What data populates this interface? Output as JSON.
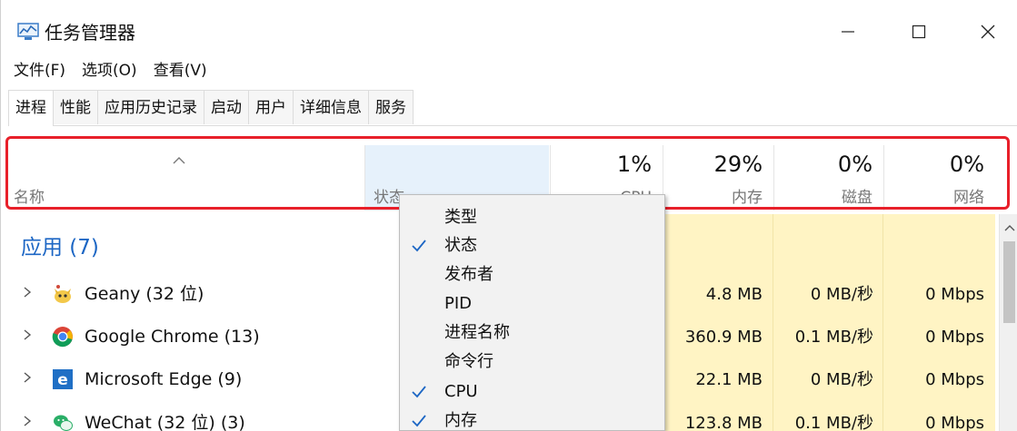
{
  "window": {
    "title": "任务管理器",
    "controls": {
      "minimize": "—",
      "maximize": "☐",
      "close": "✕"
    }
  },
  "menu": [
    "文件(F)",
    "选项(O)",
    "查看(V)"
  ],
  "tabs": [
    "进程",
    "性能",
    "应用历史记录",
    "启动",
    "用户",
    "详细信息",
    "服务"
  ],
  "header": {
    "name_label": "名称",
    "status_label": "状态",
    "cpu": {
      "pct": "1%",
      "label": "CPU"
    },
    "memory": {
      "pct": "29%",
      "label": "内存"
    },
    "disk": {
      "pct": "0%",
      "label": "磁盘"
    },
    "network": {
      "pct": "0%",
      "label": "网络"
    }
  },
  "group": {
    "label": "应用 (7)"
  },
  "rows": [
    {
      "name": "Geany (32 位)",
      "icon": "geany-icon",
      "memory": "4.8 MB",
      "disk": "0 MB/秒",
      "network": "0 Mbps"
    },
    {
      "name": "Google Chrome (13)",
      "icon": "chrome-icon",
      "memory": "360.9 MB",
      "disk": "0.1 MB/秒",
      "network": "0 Mbps"
    },
    {
      "name": "Microsoft Edge (9)",
      "icon": "edge-icon",
      "memory": "22.1 MB",
      "disk": "0 MB/秒",
      "network": "0 Mbps"
    },
    {
      "name": "WeChat (32 位) (3)",
      "icon": "wechat-icon",
      "memory": "123.8 MB",
      "disk": "0.1 MB/秒",
      "network": "0 Mbps"
    }
  ],
  "context_menu": {
    "items": [
      {
        "label": "类型",
        "checked": false
      },
      {
        "label": "状态",
        "checked": true
      },
      {
        "label": "发布者",
        "checked": false
      },
      {
        "label": "PID",
        "checked": false
      },
      {
        "label": "进程名称",
        "checked": false
      },
      {
        "label": "命令行",
        "checked": false
      },
      {
        "label": "CPU",
        "checked": true
      },
      {
        "label": "内存",
        "checked": true
      }
    ]
  },
  "colors": {
    "highlight_box": "#e8202a",
    "group_label": "#1c66c4",
    "heat_column": "#fff4c4",
    "check": "#1c66c4",
    "status_header_bg": "#e6f1fb"
  }
}
